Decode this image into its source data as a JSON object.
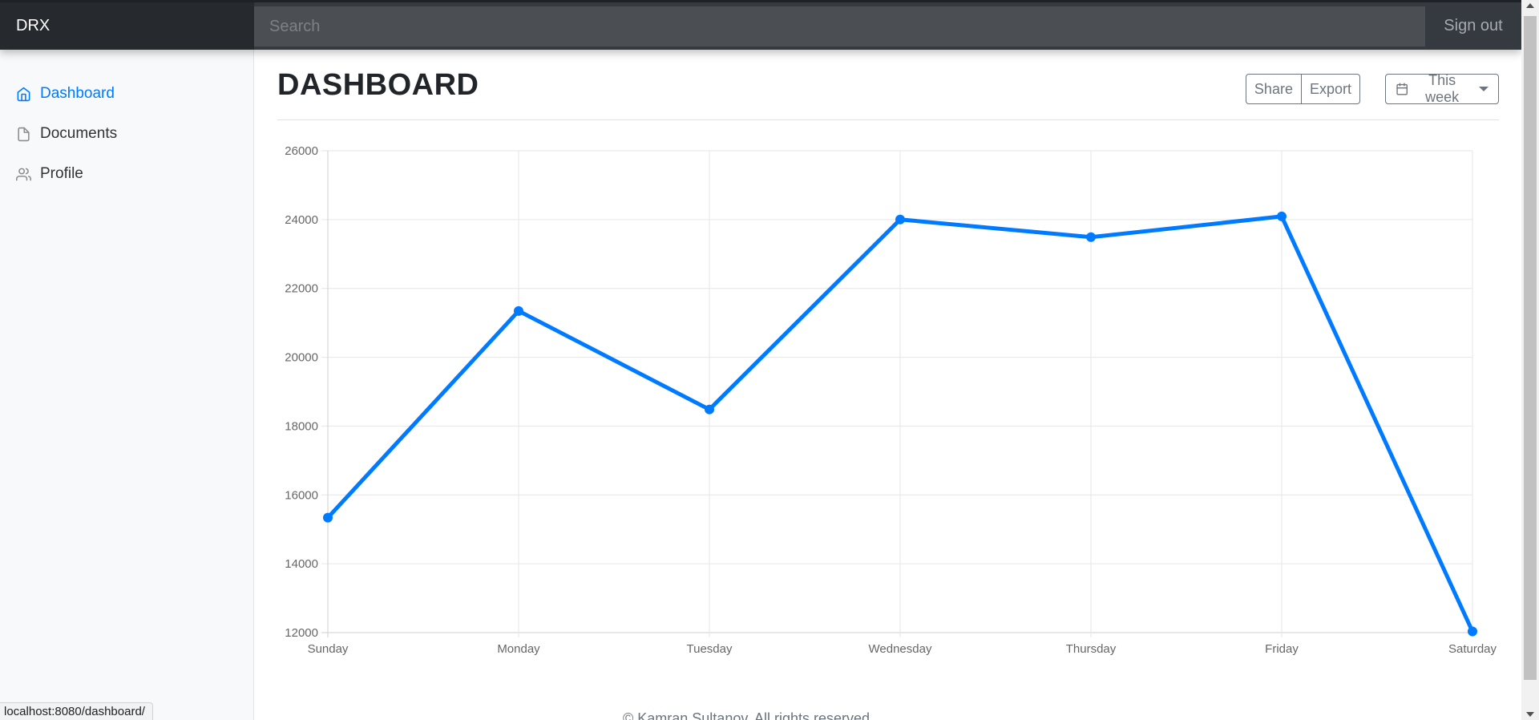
{
  "brand": "DRX",
  "search": {
    "placeholder": "Search"
  },
  "signout_label": "Sign out",
  "sidebar": {
    "items": [
      {
        "label": "Dashboard",
        "icon": "home-icon",
        "active": true
      },
      {
        "label": "Documents",
        "icon": "file-icon",
        "active": false
      },
      {
        "label": "Profile",
        "icon": "users-icon",
        "active": false
      }
    ]
  },
  "main": {
    "title": "DASHBOARD",
    "share_label": "Share",
    "export_label": "Export",
    "period_label": "This week"
  },
  "chart_data": {
    "type": "line",
    "categories": [
      "Sunday",
      "Monday",
      "Tuesday",
      "Wednesday",
      "Thursday",
      "Friday",
      "Saturday"
    ],
    "series": [
      {
        "values": [
          15339,
          21345,
          18483,
          24003,
          23489,
          24092,
          12034
        ],
        "color": "#007bff"
      }
    ],
    "ylim": [
      12000,
      26000
    ],
    "yticks": [
      12000,
      14000,
      16000,
      18000,
      20000,
      22000,
      24000,
      26000
    ],
    "grid": true,
    "legend": "none",
    "title": "",
    "xlabel": "",
    "ylabel": ""
  },
  "footer": "© Kamran Sultanov. All rights reserved.",
  "status_url": "localhost:8080/dashboard/",
  "colors": {
    "accent": "#007bff",
    "navbar": "#343a40",
    "sidebar_bg": "#f8f9fa"
  }
}
